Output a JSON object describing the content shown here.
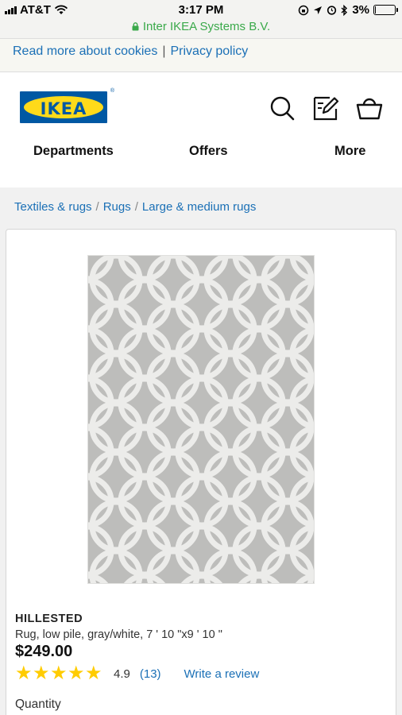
{
  "status_bar": {
    "carrier": "AT&T",
    "time": "3:17 PM",
    "battery": "3%",
    "battery_level": 0.03
  },
  "url_bar": {
    "site": "Inter IKEA Systems B.V."
  },
  "cookie_bar": {
    "read_more": "Read more about cookies",
    "separator": "|",
    "privacy": "Privacy policy"
  },
  "header": {
    "logo_text": "IKEA",
    "logo_mark": "®",
    "icons": [
      "search-icon",
      "shopping-list-icon",
      "shopping-bag-icon"
    ],
    "nav": [
      "Departments",
      "Offers",
      "More"
    ]
  },
  "breadcrumb": [
    "Textiles & rugs",
    "Rugs",
    "Large & medium rugs"
  ],
  "product": {
    "name": "HILLESTED",
    "description": "Rug, low pile, gray/white, 7 ' 10 \"x9 ' 10 \"",
    "price": "$249.00",
    "stars": 5,
    "rating": "4.9",
    "review_count": "(13)",
    "write_review": "Write a review",
    "quantity_label": "Quantity"
  },
  "colors": {
    "ikea_blue": "#0058a3",
    "ikea_yellow": "#ffda1a",
    "link_blue": "#1b70b6",
    "secure_green": "#3aa94a",
    "star_yellow": "#ffcc00"
  }
}
